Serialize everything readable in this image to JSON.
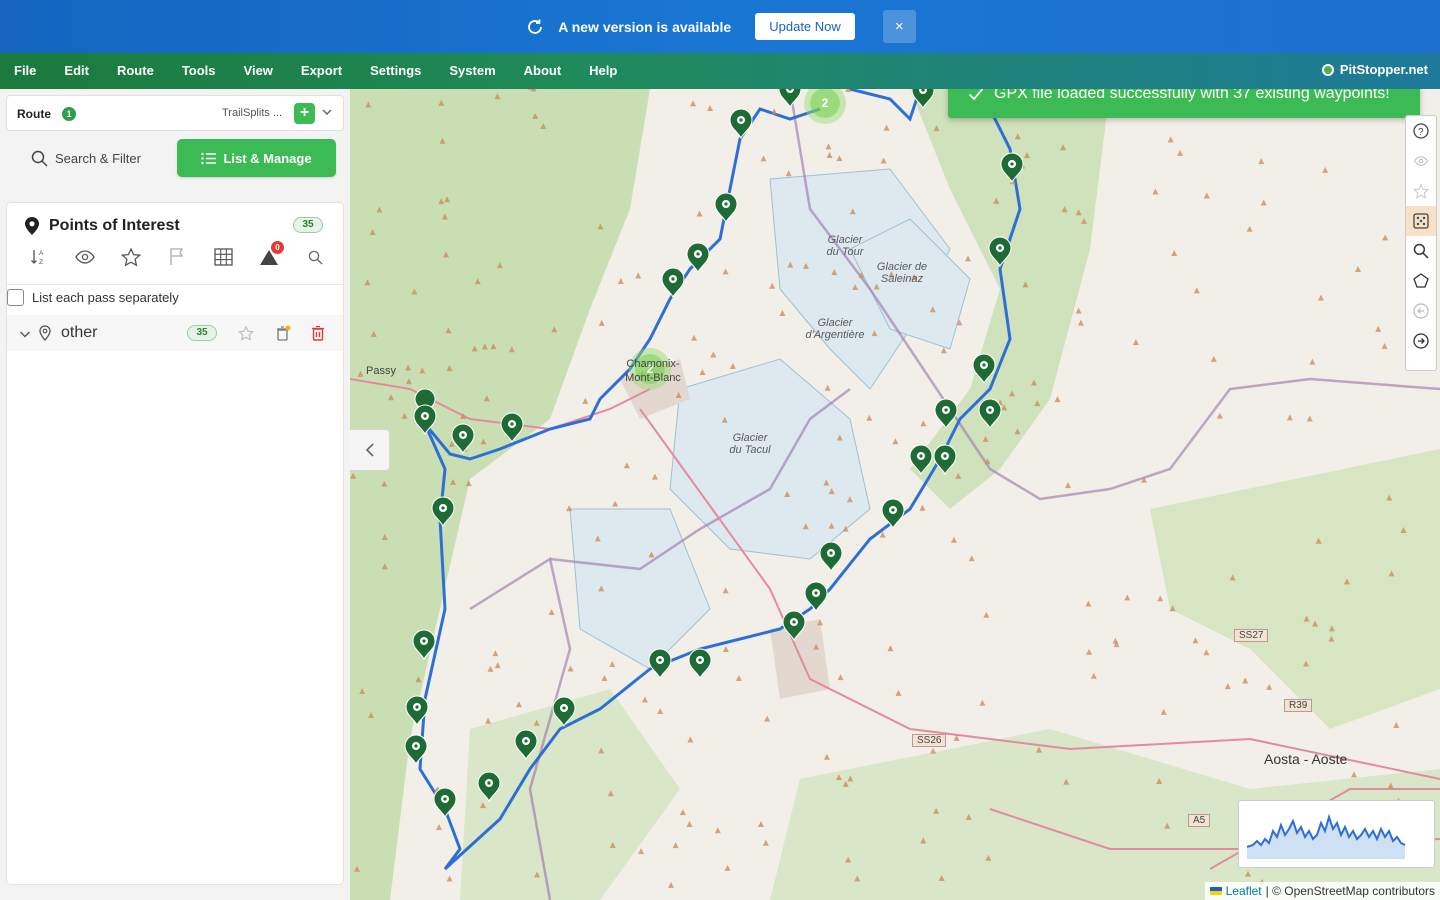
{
  "banner": {
    "message": "A new version is available",
    "update_label": "Update Now",
    "close_label": "×"
  },
  "menu": [
    "File",
    "Edit",
    "Route",
    "Tools",
    "View",
    "Export",
    "Settings",
    "System",
    "About",
    "Help"
  ],
  "site": "PitStopper.net",
  "route_box": {
    "label": "Route",
    "count": "1",
    "name": "TrailSplits ...",
    "add_label": "+"
  },
  "tabs": {
    "search": "Search & Filter",
    "list": "List & Manage"
  },
  "poi": {
    "title": "Points of Interest",
    "count": "35",
    "alert_count": "0",
    "checkbox_label": "List each pass separately",
    "group": {
      "name": "other",
      "count": "35"
    }
  },
  "toast": "GPX file loaded successfully with 37 existing waypoints!",
  "map": {
    "clusters": [
      "2",
      "2"
    ],
    "labels": {
      "glacier_tour": "Glacier du Tour",
      "glacier_saleinaz": "Glacier de Saleinaz",
      "glacier_argentiere": "Glacier d'Argentière",
      "glacier_tacul": "Glacier du Tacul",
      "chamonix": "Chamonix-Mont-Blanc",
      "passy": "Passy",
      "aosta": "Aosta - Aoste"
    },
    "roads": [
      "SS27",
      "R39",
      "SS26",
      "A5"
    ],
    "attribution_leaflet": "Leaflet",
    "attribution_osm": "| © OpenStreetMap contributors"
  },
  "colors": {
    "accent_green": "#3cba54",
    "banner_blue": "#1976d2",
    "route_blue": "#2e6fd6",
    "marker_green": "#1f6b35"
  },
  "icons": {
    "refresh": "refresh-icon",
    "close": "close-icon",
    "search": "search-icon",
    "list": "list-icon",
    "pin": "map-pin-icon"
  }
}
